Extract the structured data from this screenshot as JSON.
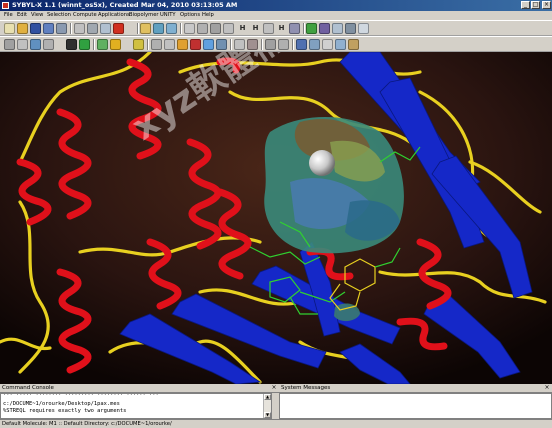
{
  "window": {
    "title": "SYBYL-X 1.1 (winnt_os5x), Created Mar 04, 2010 03:13:05 AM",
    "minimize_glyph": "_",
    "maximize_glyph": "□",
    "close_glyph": "×"
  },
  "menubar": {
    "items": [
      "File",
      "Edit",
      "View",
      "Selection",
      "Compute",
      "Applications",
      "Biopolymer",
      "UNITY",
      "Options",
      "Help"
    ]
  },
  "toolbar": {
    "text_buttons": [
      "H",
      "H",
      "H"
    ]
  },
  "viewport": {
    "background": "#000000",
    "helix_color": "#e0101a",
    "sheet_color": "#1528c8",
    "coil_color": "#e8d020",
    "surface_colors": [
      "#3a8a7a",
      "#8aa050",
      "#7a5a30",
      "#4a7ab0",
      "#2a6a8a"
    ],
    "ligand_colors": [
      "#30d030",
      "#e8d020"
    ],
    "watermark": "xyz軟體補給站 31.to/xyz"
  },
  "command_console": {
    "title": "Command Console",
    "close_glyph": "×",
    "lines": [
      "... ..... ........ ......... ........ ...... ...",
      "c:/DOCUME~1/orourke/Desktop/1pax.mes",
      "%STREQL requires exactly two arguments"
    ]
  },
  "system_messages": {
    "title": "System Messages",
    "close_glyph": "×"
  },
  "statusbar": {
    "text": "Default Molecule: M1 :: Default Directory: c:/DOCUME~1/orourke/"
  }
}
